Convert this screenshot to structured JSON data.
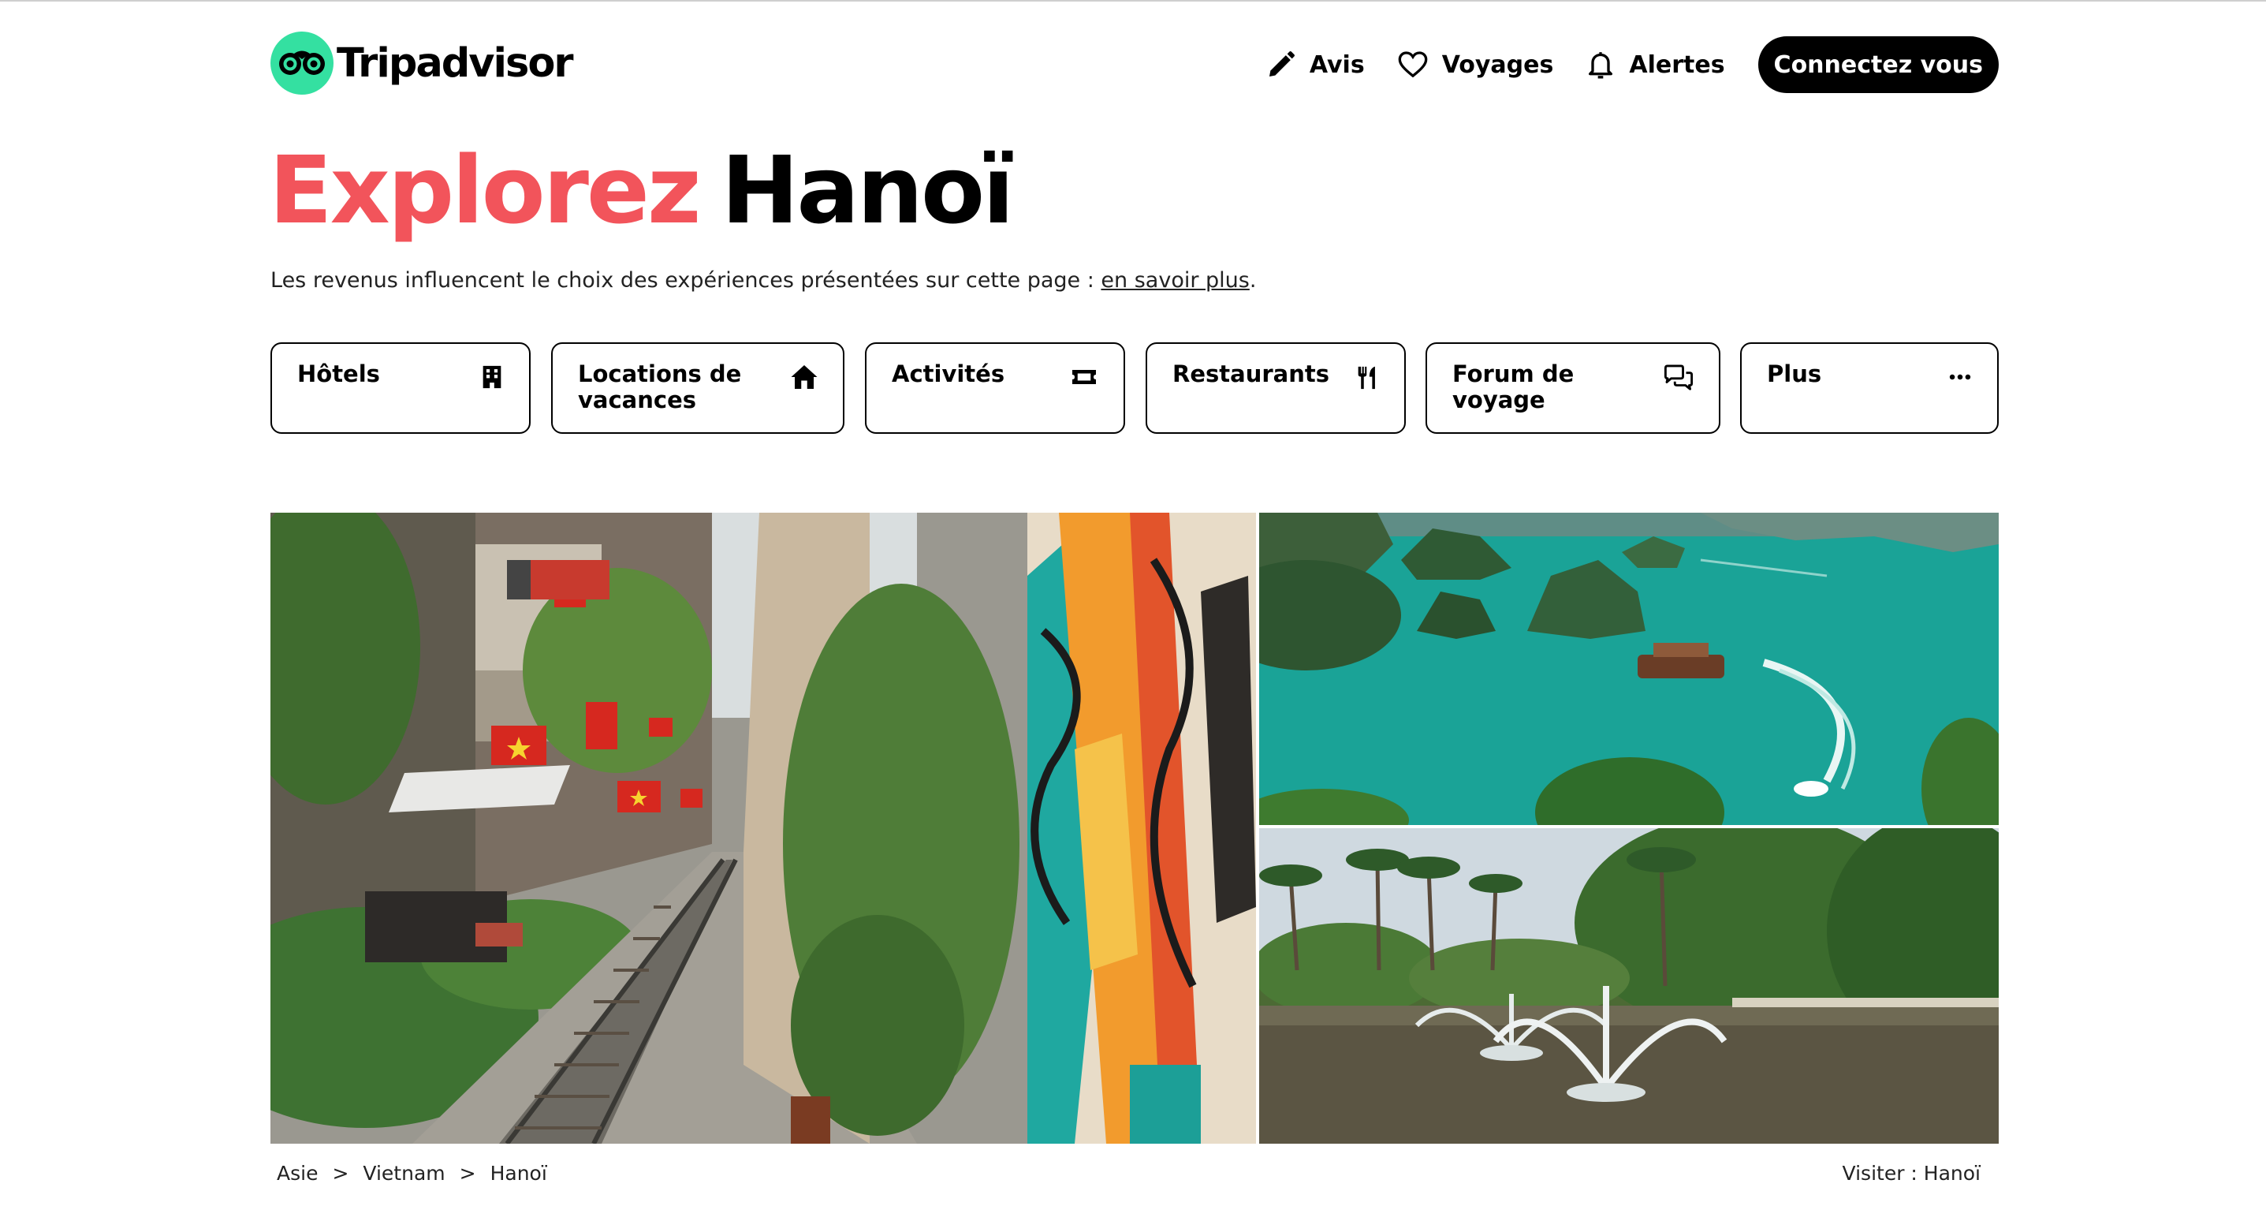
{
  "brand": {
    "name": "Tripadvisor",
    "accent": "#34e0a1"
  },
  "nav": {
    "reviews": "Avis",
    "trips": "Voyages",
    "alerts": "Alertes",
    "login": "Connectez vous"
  },
  "headline": {
    "accent": "Explorez",
    "city": "Hanoï",
    "accent_color": "#f2545b"
  },
  "disclaimer": {
    "text": "Les revenus influencent le choix des expériences présentées sur cette page : ",
    "link": "en savoir plus",
    "end": "."
  },
  "categories": [
    {
      "line1": "Hôtels",
      "line2": "",
      "icon": "hotel-icon"
    },
    {
      "line1": "Locations de",
      "line2": "vacances",
      "icon": "home-icon"
    },
    {
      "line1": "Activités",
      "line2": "",
      "icon": "ticket-icon"
    },
    {
      "line1": "Restaurants",
      "line2": "",
      "icon": "fork-knife-icon"
    },
    {
      "line1": "Forum de",
      "line2": "voyage",
      "icon": "chat-bubbles-icon"
    },
    {
      "line1": "Plus",
      "line2": "",
      "icon": "more-dots-icon"
    }
  ],
  "photos": [
    {
      "subject": "Hanoi train street with flags and murals"
    },
    {
      "subject": "Ha Long Bay with karst islands and boat"
    },
    {
      "subject": "Park with fountains and palm trees"
    }
  ],
  "breadcrumb": {
    "items": [
      "Asie",
      "Vietnam",
      "Hanoï"
    ],
    "separator": ">"
  },
  "visit": "Visiter : Hanoï"
}
